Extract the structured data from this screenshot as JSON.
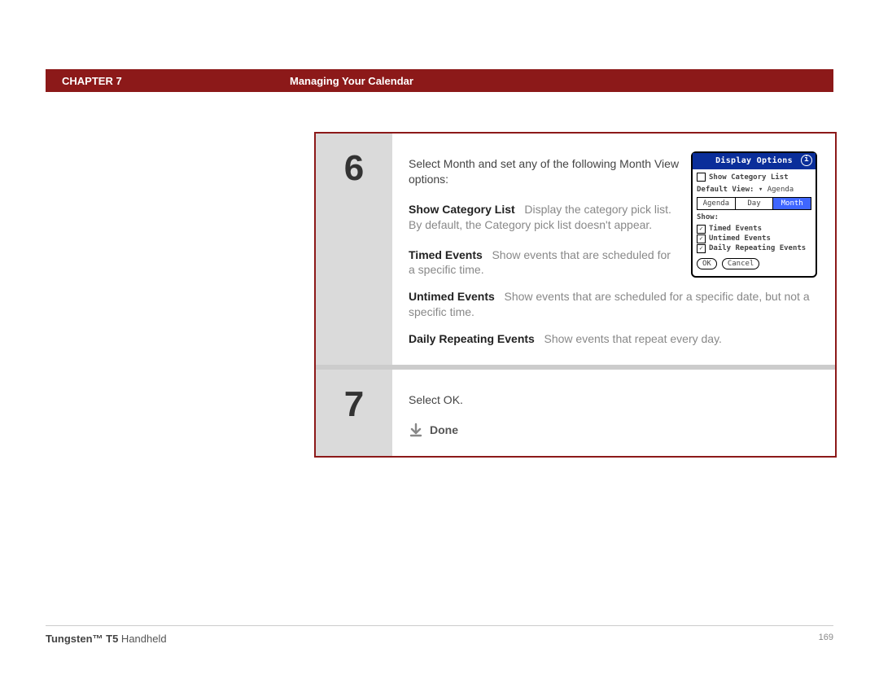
{
  "header": {
    "chapter_label": "CHAPTER 7",
    "title": "Managing Your Calendar"
  },
  "steps": {
    "six": {
      "num": "6",
      "intro": "Select Month and set any of the following Month View options:",
      "opts": {
        "show_cat": {
          "label": "Show Category List",
          "desc": "Display the category pick list. By default, the Category pick list doesn't appear."
        },
        "timed": {
          "label": "Timed Events",
          "desc": "Show events that are scheduled for a specific time."
        },
        "untimed": {
          "label": "Untimed Events",
          "desc": "Show events that are scheduled for a specific date, but not a specific time."
        },
        "daily": {
          "label": "Daily Repeating Events",
          "desc": "Show events that repeat every day."
        }
      }
    },
    "seven": {
      "num": "7",
      "text": "Select OK.",
      "done": "Done"
    }
  },
  "palm": {
    "title": "Display Options",
    "show_cat": "Show Category List",
    "default_label": "Default View:",
    "default_value": "Agenda",
    "tabs": {
      "agenda": "Agenda",
      "day": "Day",
      "month": "Month"
    },
    "show_label": "Show:",
    "opt_timed": "Timed Events",
    "opt_untimed": "Untimed Events",
    "opt_daily": "Daily Repeating Events",
    "ok": "OK",
    "cancel": "Cancel"
  },
  "footer": {
    "product_bold": "Tungsten™ T5",
    "product_rest": " Handheld",
    "page": "169"
  }
}
